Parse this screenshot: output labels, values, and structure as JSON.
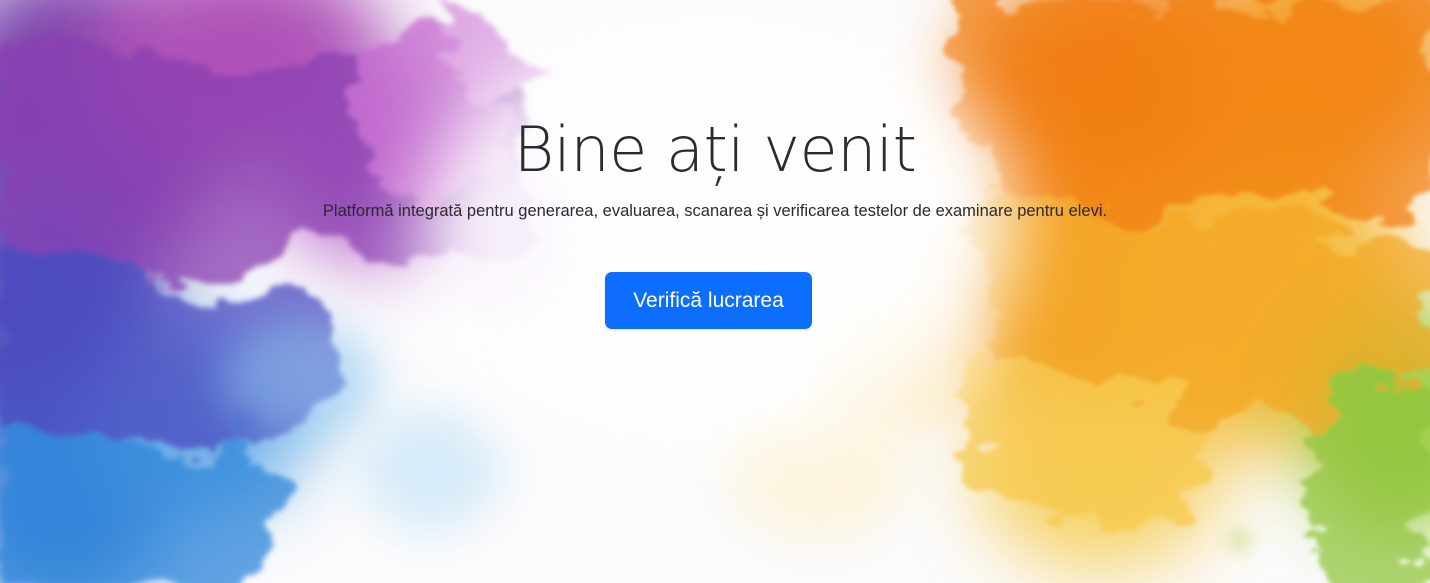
{
  "hero": {
    "title": "Bine ați venit",
    "subtitle": "Platformă integrată pentru generarea, evaluarea, scanarea și verificarea testelor de examinare pentru elevi.",
    "cta_label": "Verifică lucrarea"
  },
  "colors": {
    "primary_button": "#0d6efd",
    "button_text": "#ffffff",
    "title_text": "#2b2b30",
    "background": "#fdfdfd"
  },
  "background_image": {
    "description_icon": "watercolor-smoke-icon"
  }
}
